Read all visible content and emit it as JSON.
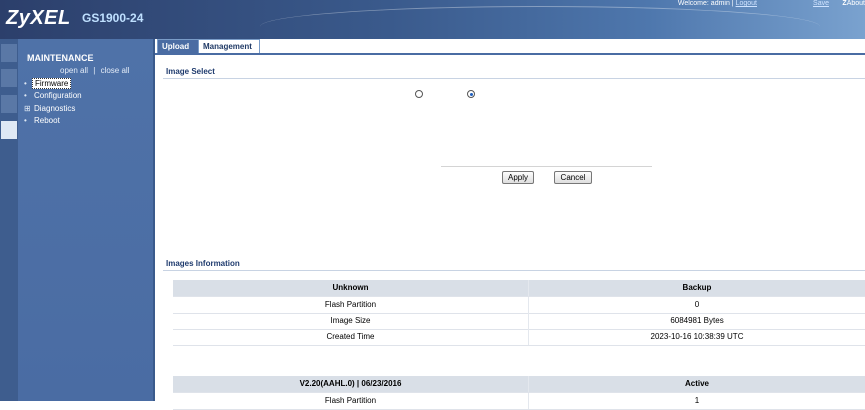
{
  "header": {
    "brand": "ZyXEL",
    "model": "GS1900-24",
    "welcome": "Welcome: admin |",
    "logout": "Logout",
    "save": "Save",
    "about": "About"
  },
  "sidebar": {
    "title": "MAINTENANCE",
    "open_all": "open all",
    "separator": "|",
    "close_all": "close all",
    "items": [
      {
        "marker": "•",
        "label": "Firmware"
      },
      {
        "marker": "•",
        "label": "Configuration"
      },
      {
        "marker": "⊞",
        "label": "Diagnostics"
      },
      {
        "marker": "•",
        "label": "Reboot"
      }
    ]
  },
  "tabs": [
    {
      "label": "Upload"
    },
    {
      "label": "Management"
    }
  ],
  "image_select": {
    "title": "Image Select",
    "radio_1_selected": false,
    "radio_2_selected": true,
    "apply_label": "Apply",
    "cancel_label": "Cancel"
  },
  "images_info": {
    "title": "Images Information",
    "rows": [
      {
        "left": "Unknown",
        "right": "Backup",
        "header": true
      },
      {
        "left": "Flash Partition",
        "right": "0"
      },
      {
        "left": "Image Size",
        "right": "6084981 Bytes"
      },
      {
        "left": "Created Time",
        "right": "2023-10-16 10:38:39 UTC"
      },
      {
        "left": "V2.20(AAHL.0) | 06/23/2016",
        "right": "Active",
        "header": true
      },
      {
        "left": "Flash Partition",
        "right": "1"
      }
    ]
  },
  "colors": {
    "header_dark": "#2c3f6b",
    "sidebar": "#4a6ca3",
    "section_title": "#1f3b6e",
    "table_header": "#d9dfe7"
  }
}
